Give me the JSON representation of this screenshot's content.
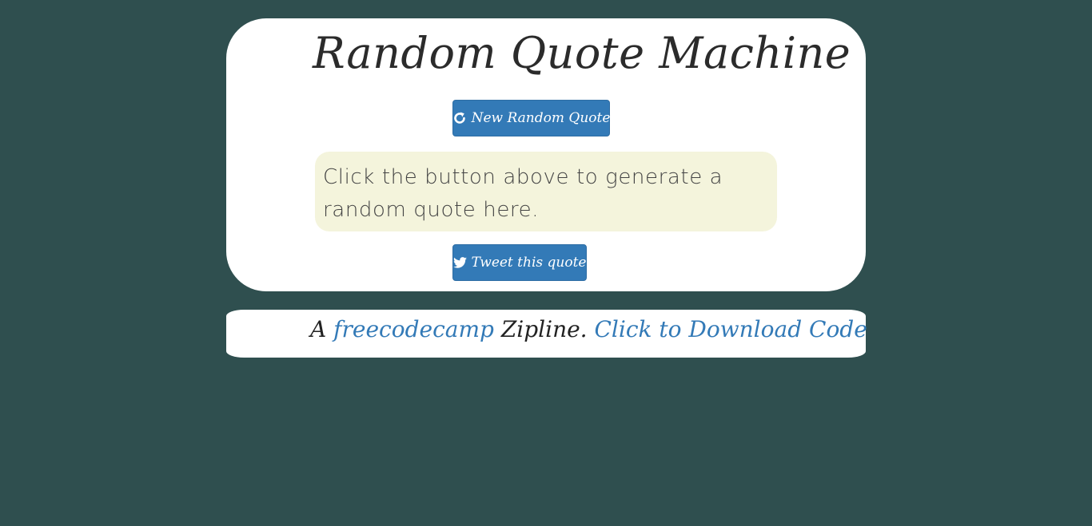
{
  "header": {
    "title": "Random Quote Machine"
  },
  "actions": {
    "new_quote_label": "New Random Quote",
    "new_quote_icon": "refresh-icon",
    "tweet_label": "Tweet this quote",
    "tweet_icon": "twitter-icon"
  },
  "quote": {
    "text": "Click the button above to generate a random quote here."
  },
  "footer": {
    "prefix": "A",
    "link1": "freecodecamp",
    "middle": "Zipline.",
    "link2": "Click to Download Code"
  },
  "colors": {
    "background": "#2f4f4f",
    "card": "#ffffff",
    "button": "#337ab7",
    "quote_box": "#f4f4dc",
    "link": "#337ab7"
  }
}
